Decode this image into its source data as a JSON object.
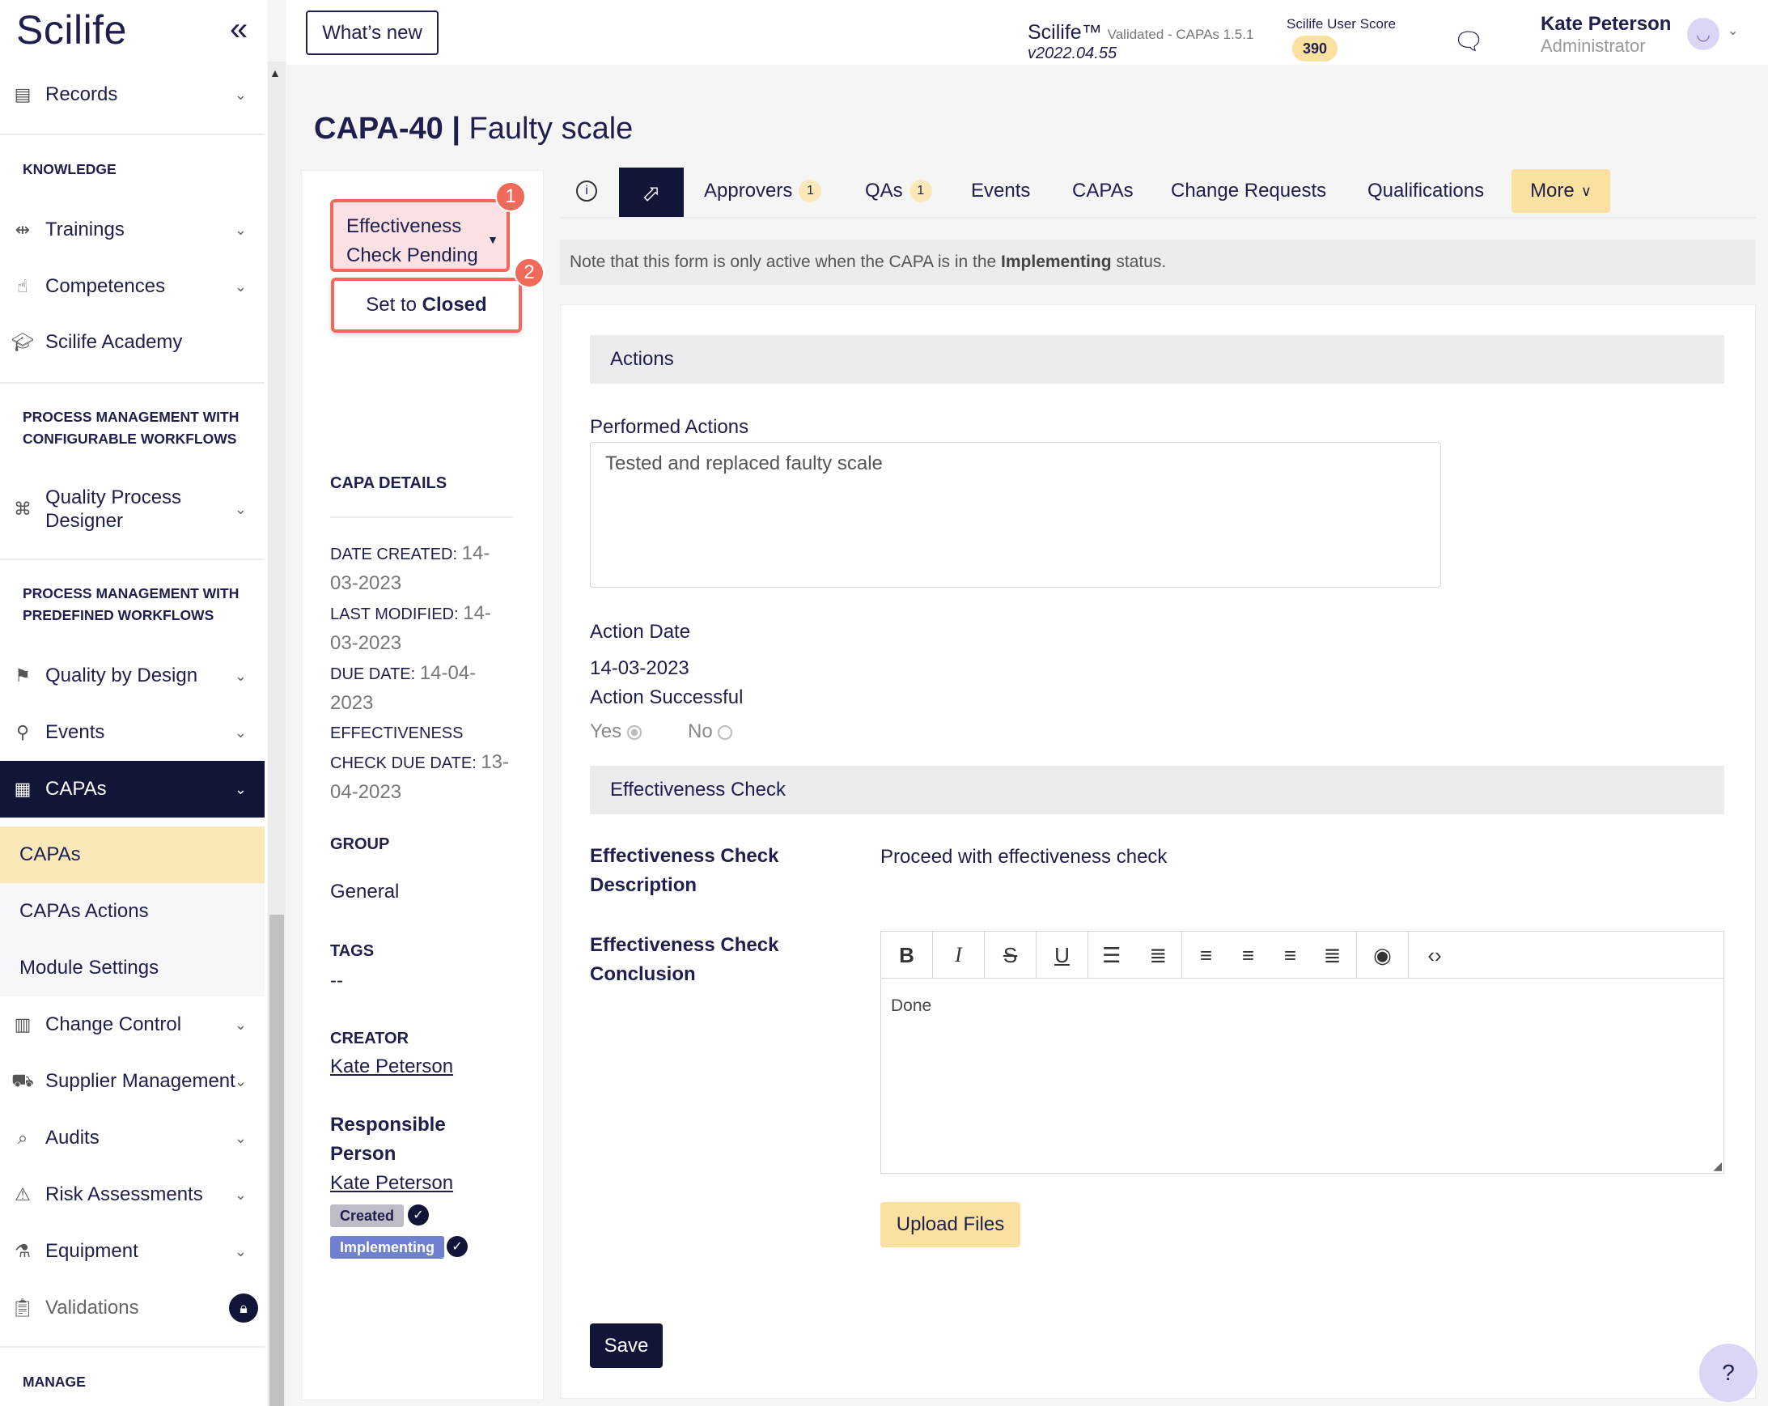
{
  "app": {
    "logo": "Scilife",
    "whats_new": "What’s new",
    "product": "Scilife™",
    "validated": "Validated - CAPAs 1.5.1",
    "version": "v2022.04.55",
    "score_label": "Scilife User Score",
    "score": "390",
    "user_name": "Kate Peterson",
    "user_role": "Administrator"
  },
  "sidebar": {
    "records": "Records",
    "section_knowledge": "KNOWLEDGE",
    "trainings": "Trainings",
    "competences": "Competences",
    "academy": "Scilife Academy",
    "section_configurable": "PROCESS MANAGEMENT WITH CONFIGURABLE WORKFLOWS",
    "qpd": "Quality Process Designer",
    "section_predefined": "PROCESS MANAGEMENT WITH PREDEFINED WORKFLOWS",
    "qbd": "Quality by Design",
    "events": "Events",
    "capas": "CAPAs",
    "sub_capas": "CAPAs",
    "sub_actions": "CAPAs Actions",
    "sub_settings": "Module Settings",
    "change_control": "Change Control",
    "supplier": "Supplier Management",
    "audits": "Audits",
    "risk": "Risk Assessments",
    "equipment": "Equipment",
    "validations": "Validations",
    "section_manage": "MANAGE"
  },
  "page": {
    "id": "CAPA-40",
    "separator": "|",
    "title": "Faulty scale"
  },
  "status": {
    "current": "Effectiveness Check Pending",
    "action_prefix": "Set to ",
    "action_bold": "Closed",
    "step1": "1",
    "step2": "2"
  },
  "details": {
    "heading": "CAPA DETAILS",
    "created_label": "DATE CREATED:",
    "created": "14-03-2023",
    "modified_label": "LAST MODIFIED:",
    "modified": "14-03-2023",
    "due_label": "DUE DATE:",
    "due": "14-04-2023",
    "eff_label": "EFFECTIVENESS CHECK DUE DATE:",
    "eff_due": "13-04-2023",
    "group_heading": "GROUP",
    "group": "General",
    "tags_heading": "TAGS",
    "tags": "--",
    "creator_heading": "CREATOR",
    "creator": "Kate Peterson",
    "responsible_heading": "Responsible Person",
    "responsible": "Kate Peterson",
    "tag_created": "Created",
    "tag_implementing": "Implementing"
  },
  "tabs": {
    "approvers": "Approvers",
    "approvers_count": "1",
    "qas": "QAs",
    "qas_count": "1",
    "events": "Events",
    "capas": "CAPAs",
    "change_requests": "Change Requests",
    "qualifications": "Qualifications",
    "more": "More"
  },
  "form": {
    "notice_pre": "Note that this form is only active when the CAPA is in the ",
    "notice_bold": "Implementing",
    "notice_post": " status.",
    "actions_section": "Actions",
    "performed_label": "Performed Actions",
    "performed_value": "Tested and replaced faulty scale",
    "action_date_label": "Action Date",
    "action_date": "14-03-2023",
    "success_label": "Action Successful",
    "yes": "Yes",
    "no": "No",
    "eff_section": "Effectiveness Check",
    "eff_desc_label": "Effectiveness Check Description",
    "eff_desc_value": "Proceed with effectiveness check",
    "eff_conc_label": "Effectiveness Check Conclusion",
    "eff_conc_value": "Done",
    "upload": "Upload Files",
    "save": "Save"
  },
  "colors": {
    "navy": "#111537",
    "accent_yellow": "#fbe8b8",
    "highlight_red": "#ef6a5a"
  }
}
